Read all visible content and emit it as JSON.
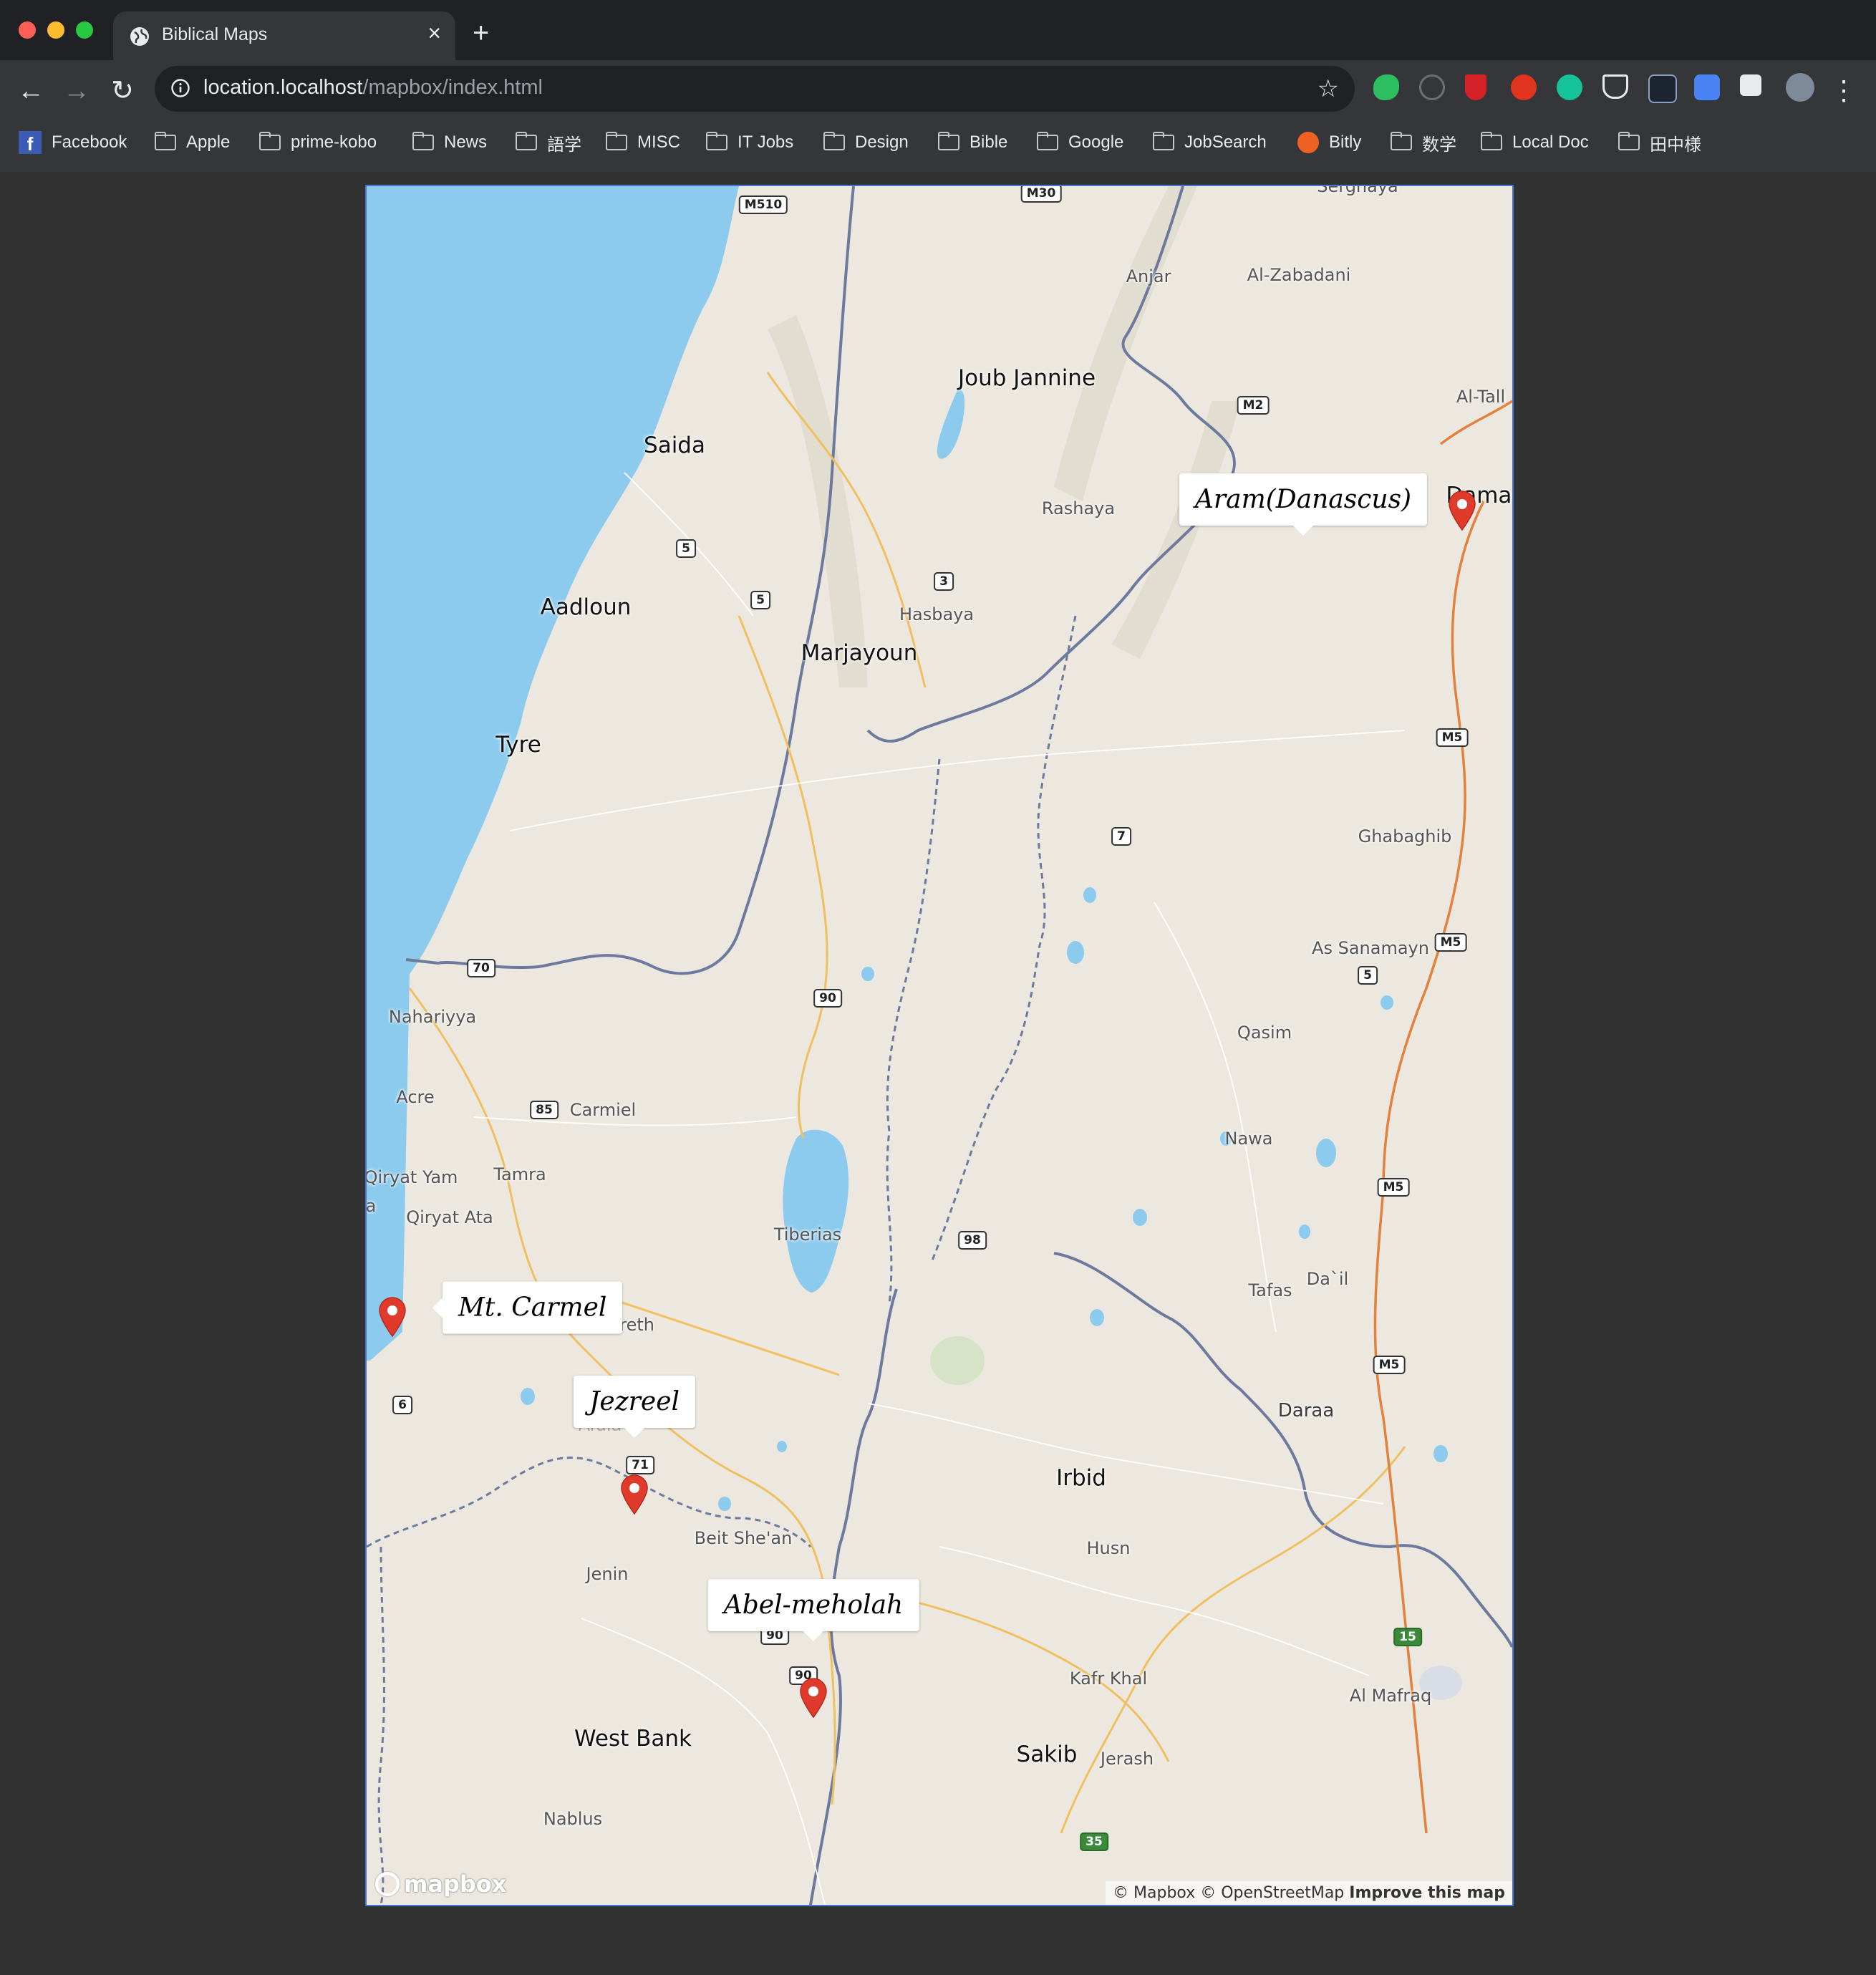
{
  "browser": {
    "tab_title": "Biblical Maps",
    "close_symbol": "×",
    "new_tab_symbol": "+",
    "url_host": "location.localhost",
    "url_path": "/mapbox/index.html",
    "back_symbol": "←",
    "forward_symbol": "→",
    "reload_symbol": "↻",
    "star_symbol": "☆",
    "menu_symbol": "⋮"
  },
  "bookmarks": [
    {
      "label": "Facebook",
      "icon": "facebook-icon"
    },
    {
      "label": "Apple",
      "icon": "folder-icon"
    },
    {
      "label": "prime-kobo",
      "icon": "folder-icon"
    },
    {
      "label": "News",
      "icon": "folder-icon"
    },
    {
      "label": "語学",
      "icon": "folder-icon"
    },
    {
      "label": "MISC",
      "icon": "folder-icon"
    },
    {
      "label": "IT Jobs",
      "icon": "folder-icon"
    },
    {
      "label": "Design",
      "icon": "folder-icon"
    },
    {
      "label": "Bible",
      "icon": "folder-icon"
    },
    {
      "label": "Google",
      "icon": "folder-icon"
    },
    {
      "label": "JobSearch",
      "icon": "folder-icon"
    },
    {
      "label": "Bitly",
      "icon": "bitly-icon"
    },
    {
      "label": "数学",
      "icon": "folder-icon"
    },
    {
      "label": "Local Doc",
      "icon": "folder-icon"
    },
    {
      "label": "田中様",
      "icon": "folder-icon"
    }
  ],
  "map": {
    "places": {
      "serghaya": "Serghaya",
      "anjar": "Anjar",
      "al_zabadani": "Al-Zabadani",
      "joub_jannine": "Joub Jannine",
      "al_tall": "Al-Tall",
      "saida": "Saida",
      "rashaya": "Rashaya",
      "damascus": "Damasc",
      "aadloun": "Aadloun",
      "hasbaya": "Hasbaya",
      "marjayoun": "Marjayoun",
      "tyre": "Tyre",
      "ghabaghib": "Ghabaghib",
      "as_sanamayn": "As Sanamayn",
      "nahariyya": "Nahariyya",
      "qasim": "Qasim",
      "acre": "Acre",
      "carmiel": "Carmiel",
      "nawa": "Nawa",
      "qiryat_yam": "Qiryat Yam",
      "tamra": "Tamra",
      "qiryat_ata": "Qiryat Ata",
      "tiberias": "Tiberias",
      "tafas": "Tafas",
      "dail": "Da`il",
      "nazareth": "zareth",
      "daraa": "Daraa",
      "afula": "Afula",
      "irbid": "Irbid",
      "beit_shean": "Beit She'an",
      "husn": "Husn",
      "jenin": "Jenin",
      "kafr_khal": "Kafr Khal",
      "al_mafraq": "Al Mafraq",
      "west_bank": "West Bank",
      "sakib": "Sakib",
      "jerash": "Jerash",
      "nablus": "Nablus",
      "ha": "a"
    },
    "shields": {
      "m510": "M510",
      "m30": "M30",
      "m2": "M2",
      "r5a": "5",
      "r5b": "5",
      "r3": "3",
      "m5a": "M5",
      "r7": "7",
      "m5b": "M5",
      "r5c": "5",
      "r70": "70",
      "r90a": "90",
      "r85": "85",
      "m5c": "M5",
      "r98": "98",
      "m5d": "M5",
      "r6": "6",
      "r71": "71",
      "r90b": "90",
      "r90c": "90",
      "r15": "15",
      "r35": "35"
    },
    "popups": {
      "aram": "Aram(Danascus)",
      "carmel": "Mt. Carmel",
      "jezreel": "Jezreel",
      "abel": "Abel-meholah"
    },
    "logo": "mapbox",
    "attribution": {
      "mapbox": "© Mapbox",
      "osm": "© OpenStreetMap",
      "improve": "Improve this map"
    },
    "colors": {
      "water": "#8ccbee",
      "land": "#ece8df",
      "marker": "#e03a2a",
      "border": "#5b6b9a",
      "road": "#f0c060"
    }
  }
}
